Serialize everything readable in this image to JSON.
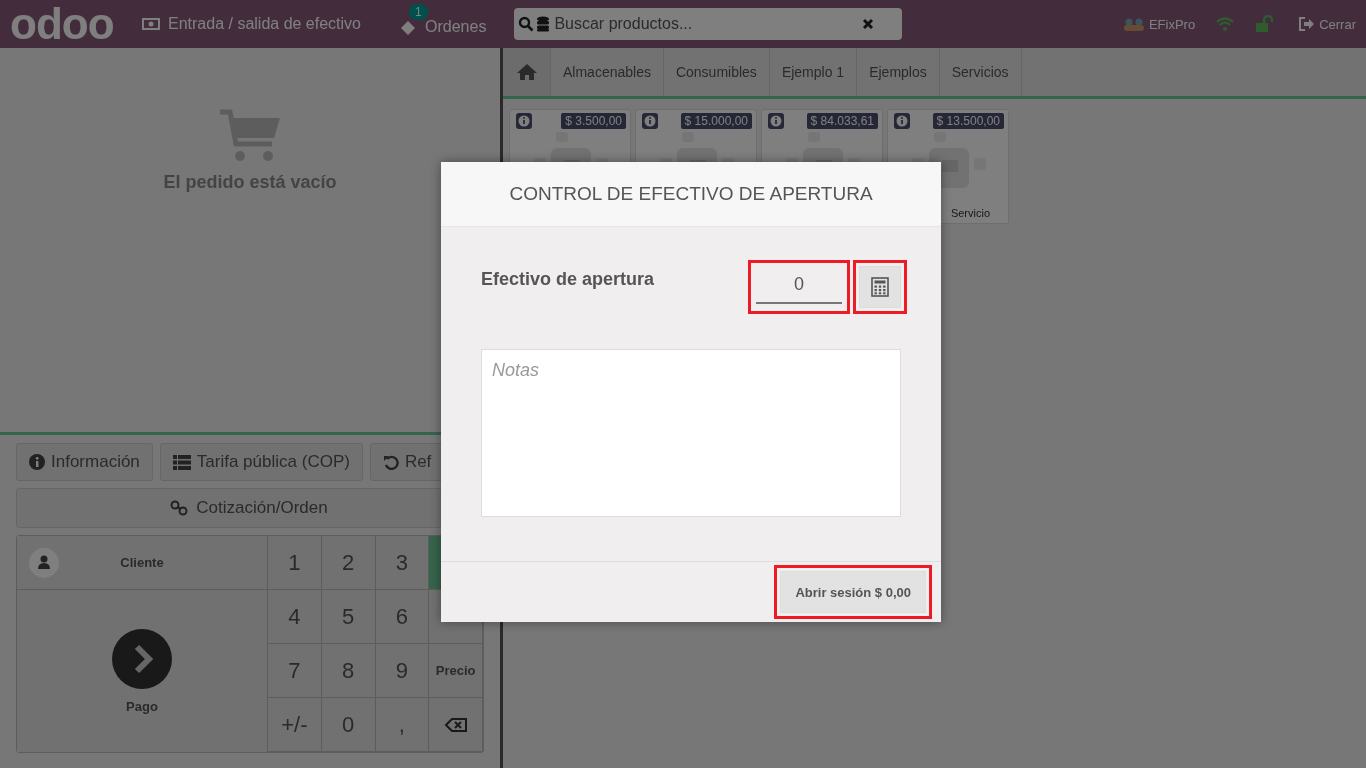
{
  "header": {
    "logo": "odoo",
    "cash_button": "Entrada / salida de efectivo",
    "orders_button": {
      "label": "Ordenes",
      "badge": "1"
    },
    "search": {
      "placeholder": "Buscar productos..."
    },
    "user": "EFixPro",
    "logout": "Cerrar"
  },
  "order": {
    "empty_text": "El pedido está vacío"
  },
  "actions": [
    {
      "label": "Información",
      "kind": "info"
    },
    {
      "label": "Tarifa pública (COP)",
      "kind": "list"
    },
    {
      "label": "Ref",
      "kind": "refresh"
    }
  ],
  "quote_button": "Cotización/Orden",
  "customer_button": "Cliente",
  "payment_button": "Pago",
  "numpad": [
    [
      {
        "label": "1",
        "kind": "digit"
      },
      {
        "label": "2",
        "kind": "digit"
      },
      {
        "label": "3",
        "kind": "digit"
      },
      {
        "kind": "mode",
        "selected": true
      }
    ],
    [
      {
        "label": "4",
        "kind": "digit"
      },
      {
        "label": "5",
        "kind": "digit"
      },
      {
        "label": "6",
        "kind": "digit"
      },
      {
        "kind": "mode",
        "selected": false
      }
    ],
    [
      {
        "label": "7",
        "kind": "digit"
      },
      {
        "label": "8",
        "kind": "digit"
      },
      {
        "label": "9",
        "kind": "digit"
      },
      {
        "label": "Precio",
        "kind": "mode",
        "selected": false
      }
    ],
    [
      {
        "label": "+/-",
        "kind": "digit"
      },
      {
        "label": "0",
        "kind": "digit"
      },
      {
        "label": ",",
        "kind": "digit"
      },
      {
        "kind": "backspace"
      }
    ]
  ],
  "categories": [
    {
      "label": "Almacenables"
    },
    {
      "label": "Consumibles"
    },
    {
      "label": "Ejemplo 1"
    },
    {
      "label": "Ejemplos"
    },
    {
      "label": "Servicios"
    }
  ],
  "products": [
    {
      "price": "$ 3.500,00"
    },
    {
      "price": "$ 15.000,00"
    },
    {
      "price": "$ 84.033,61"
    },
    {
      "price": "$ 13.500,00",
      "name": "Servicio"
    }
  ],
  "dialog": {
    "title": "CONTROL DE EFECTIVO DE APERTURA",
    "cash_label": "Efectivo de apertura",
    "cash_value": {
      "value": "0",
      "highlighted": true
    },
    "calculator_highlighted": true,
    "notes": {
      "placeholder": "Notas"
    },
    "open_button": {
      "label": "Abrir sesión $ 0,00",
      "highlighted": true
    }
  }
}
